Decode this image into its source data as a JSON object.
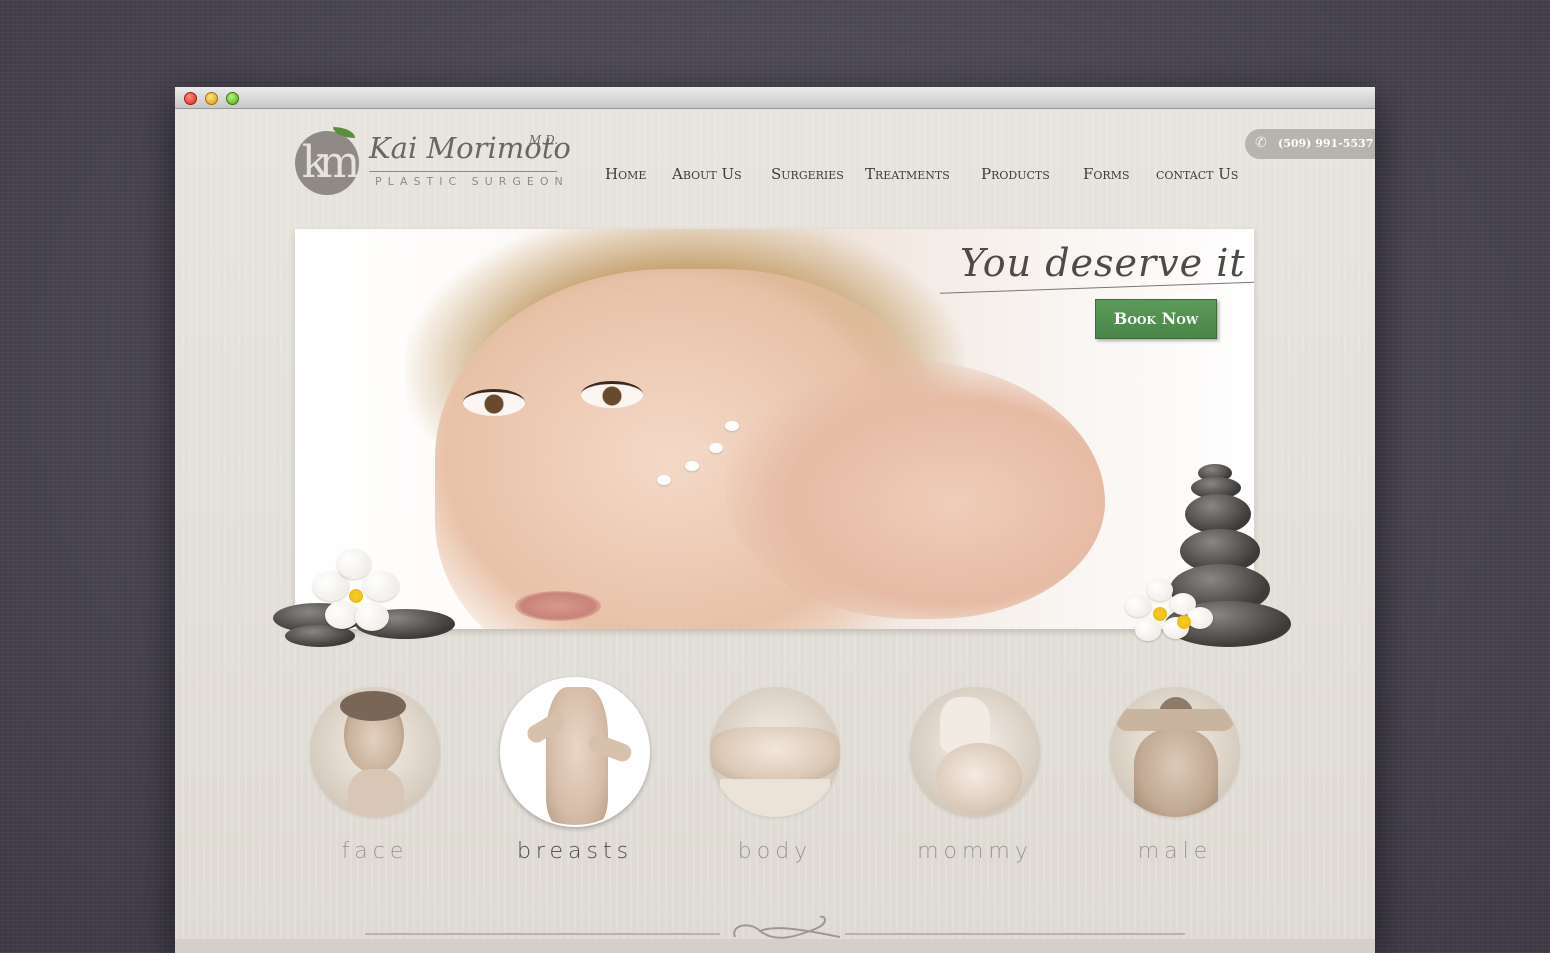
{
  "window": {
    "controls": [
      "close",
      "minimize",
      "zoom"
    ]
  },
  "logo": {
    "initials": "km",
    "name": "Kai Morimoto",
    "degree": "M.D.",
    "subtitle": "PLASTIC SURGEON"
  },
  "phone": {
    "icon": "phone-icon",
    "number": "(509) 991-5537"
  },
  "nav": {
    "items": [
      {
        "label": "Home"
      },
      {
        "label": "About Us"
      },
      {
        "label": "Surgeries"
      },
      {
        "label": "Treatments"
      },
      {
        "label": "Products"
      },
      {
        "label": "Forms"
      },
      {
        "label": "contact Us"
      }
    ]
  },
  "hero": {
    "tagline": "You deserve it",
    "cta": "Book Now"
  },
  "categories": [
    {
      "label": "face",
      "active": false
    },
    {
      "label": "breasts",
      "active": true
    },
    {
      "label": "body",
      "active": false
    },
    {
      "label": "mommy",
      "active": false
    },
    {
      "label": "male",
      "active": false
    }
  ],
  "colors": {
    "accent_green": "#4f8a4d",
    "page_bg": "#e6e3dd",
    "outer_bg": "#4a4654",
    "nav_text": "#3f3b38"
  }
}
